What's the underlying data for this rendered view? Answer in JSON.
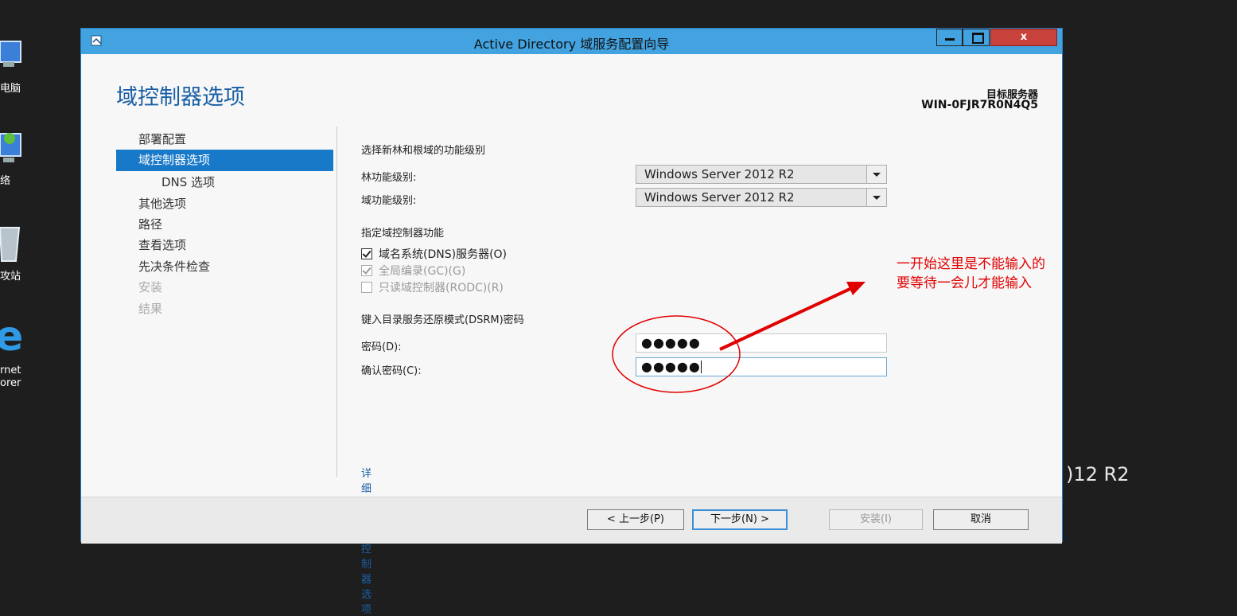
{
  "desktop": {
    "icons": [
      {
        "label": "电脑",
        "icon": "computer-icon"
      },
      {
        "label": "络",
        "icon": "network-icon"
      },
      {
        "label": "攻站",
        "icon": "recycle-bin-icon"
      },
      {
        "label": "rnet\norer",
        "icon": "internet-explorer-icon"
      }
    ],
    "watermark": ")12 R2"
  },
  "window": {
    "title": "Active Directory 域服务配置向导",
    "controls": {
      "minimize": "minimize",
      "maximize": "maximize",
      "close": "x"
    }
  },
  "header": {
    "page_title": "域控制器选项",
    "target_label": "目标服务器",
    "target_name": "WIN-0FJR7R0N4Q5"
  },
  "nav": {
    "items": [
      {
        "label": "部署配置",
        "state": "normal"
      },
      {
        "label": "域控制器选项",
        "state": "active"
      },
      {
        "label": "DNS 选项",
        "state": "sub"
      },
      {
        "label": "其他选项",
        "state": "normal"
      },
      {
        "label": "路径",
        "state": "normal"
      },
      {
        "label": "查看选项",
        "state": "normal"
      },
      {
        "label": "先决条件检查",
        "state": "normal"
      },
      {
        "label": "安装",
        "state": "disabled"
      },
      {
        "label": "结果",
        "state": "disabled"
      }
    ]
  },
  "content": {
    "functional_level_heading": "选择新林和根域的功能级别",
    "forest_label": "林功能级别:",
    "forest_value": "Windows Server 2012 R2",
    "domain_label": "域功能级别:",
    "domain_value": "Windows Server 2012 R2",
    "dc_capabilities_heading": "指定域控制器功能",
    "checkboxes": [
      {
        "label": "域名系统(DNS)服务器(O)",
        "checked": true,
        "enabled": true
      },
      {
        "label": "全局编录(GC)(G)",
        "checked": true,
        "enabled": false
      },
      {
        "label": "只读域控制器(RODC)(R)",
        "checked": false,
        "enabled": false
      }
    ],
    "dsrm_heading": "键入目录服务还原模式(DSRM)密码",
    "password_label": "密码(D):",
    "password_value": "●●●●●",
    "confirm_label": "确认密码(C):",
    "confirm_value": "●●●●●",
    "learn_more": "详细了解 域控制器选项"
  },
  "footer": {
    "back": "< 上一步(P)",
    "next": "下一步(N) >",
    "install": "安装(I)",
    "cancel": "取消"
  },
  "annotation": {
    "line1": "一开始这里是不能输入的",
    "line2": "要等待一会儿才能输入",
    "color": "#e10000"
  },
  "colors": {
    "titlebar": "#43a3e0",
    "accent": "#1979c9",
    "page_title": "#1a5fa5",
    "close": "#c7423a"
  }
}
